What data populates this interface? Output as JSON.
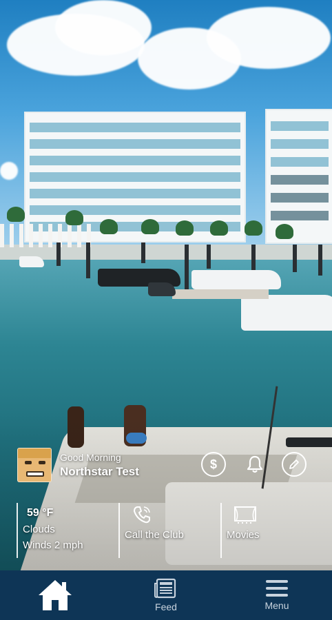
{
  "user": {
    "greeting": "Good Morning",
    "name": "Northstar Test"
  },
  "header_icons": {
    "payment": "dollar-circle-icon",
    "notifications": "bell-icon",
    "edit": "pencil-circle-icon"
  },
  "tiles": {
    "weather": {
      "temperature": "59 °F",
      "condition": "Clouds",
      "wind": "Winds 2 mph"
    },
    "call": {
      "label": "Call the Club",
      "icon": "phone-icon"
    },
    "movies": {
      "label": "Movies",
      "icon": "theater-icon"
    }
  },
  "bottom_nav": {
    "home": {
      "icon": "home-icon"
    },
    "feed": {
      "label": "Feed",
      "icon": "newspaper-icon"
    },
    "menu": {
      "label": "Menu",
      "icon": "hamburger-menu-icon"
    }
  },
  "colors": {
    "nav_background": "#0e3556",
    "nav_text": "#c8d3de",
    "overlay_text": "#ffffff"
  }
}
